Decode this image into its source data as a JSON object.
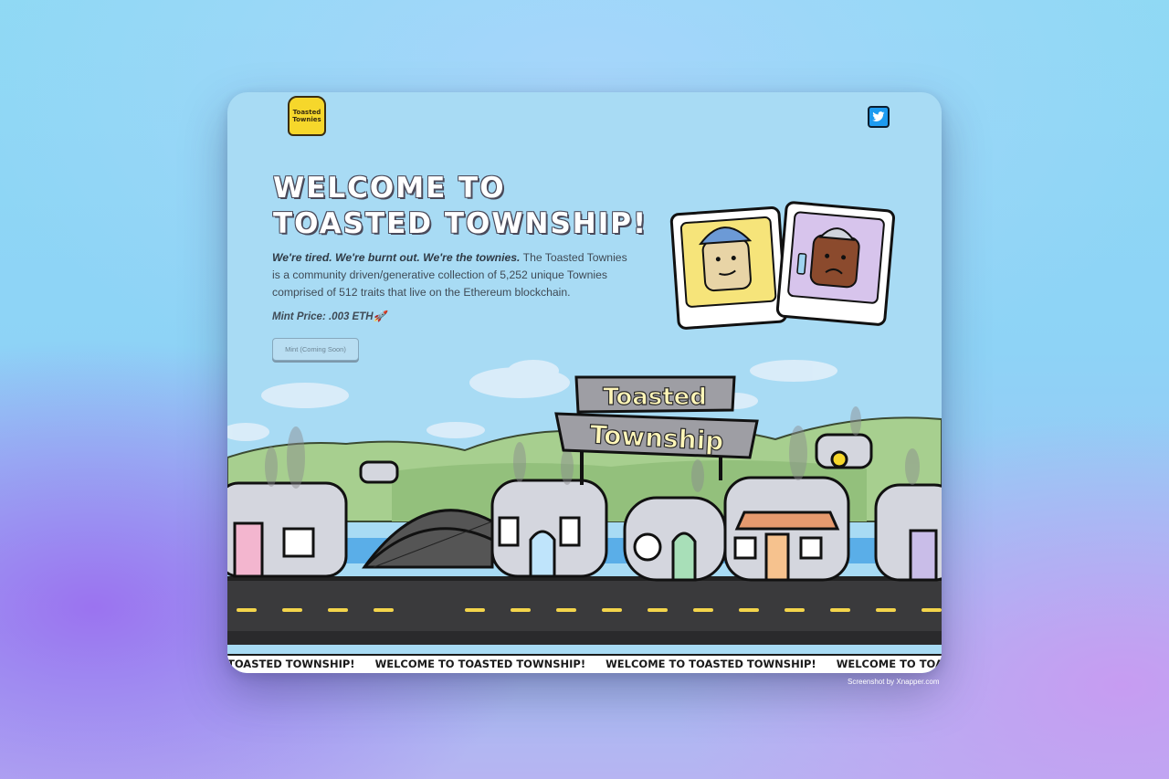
{
  "logo": {
    "text": "Toasted Townies"
  },
  "social": {
    "twitter_icon": "twitter-bird-icon"
  },
  "hero": {
    "title_line1": "WELCOME TO",
    "title_line2": "TOASTED TOWNSHIP!",
    "tagline": "We're tired. We're burnt out. We're the townies.",
    "description": " The Toasted Townies is a community driven/generative collection of 5,252 unique Townies comprised of 512 traits that live on the Ethereum blockchain.",
    "mint_price": "Mint Price: .003 ETH🚀",
    "mint_button": "Mint (Coming Soon)"
  },
  "sign": {
    "line1": "Toasted",
    "line2": "Township"
  },
  "marquee": {
    "items": [
      "TOASTED TOWNSHIP!",
      "WELCOME TO TOASTED TOWNSHIP!",
      "WELCOME TO TOASTED TOWNSHIP!",
      "WELCOME TO TOASTED TOWNSHIP!"
    ]
  },
  "credit": "Screenshot by Xnapper.com",
  "colors": {
    "sky": "#a8dbf4",
    "toast_yellow": "#f6d72b",
    "twitter_blue": "#1d9bf0",
    "road": "#3a3a3c"
  }
}
